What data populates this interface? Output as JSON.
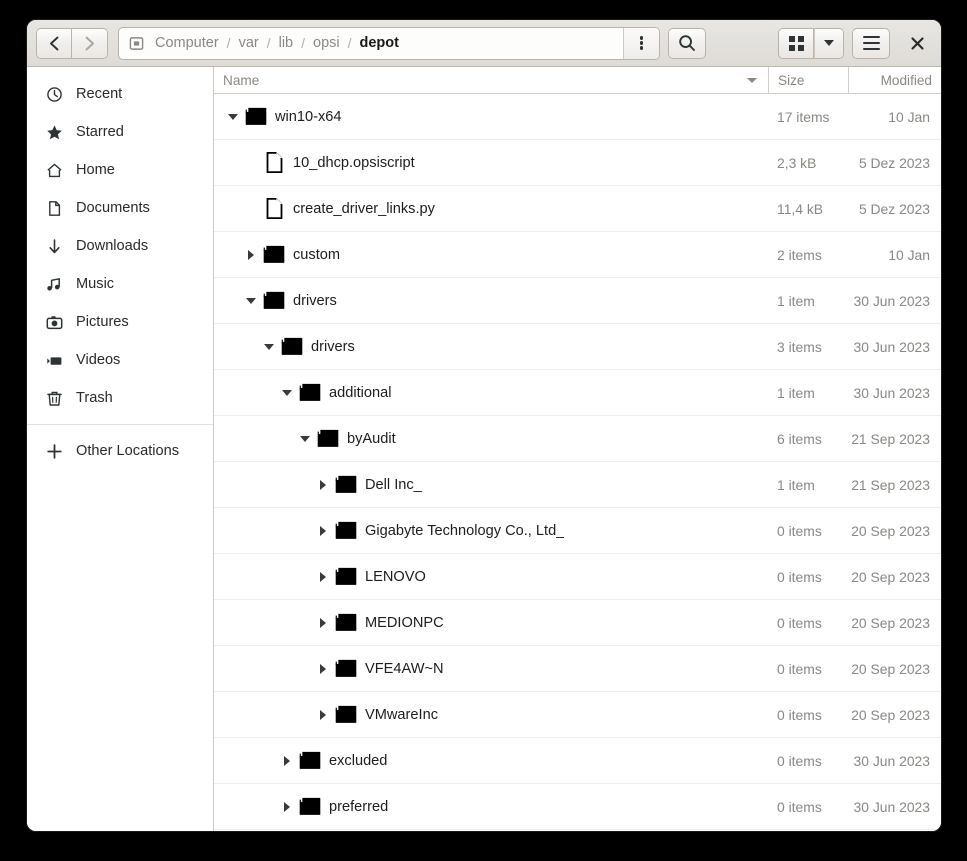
{
  "window": {
    "title": "depot",
    "close_label": "×"
  },
  "toolbar": {
    "back_label": "‹",
    "forward_label": "›",
    "path_root_icon": "computer-icon",
    "crumbs": [
      {
        "label": "Computer",
        "active": false
      },
      {
        "label": "var",
        "active": false
      },
      {
        "label": "lib",
        "active": false
      },
      {
        "label": "opsi",
        "active": false
      },
      {
        "label": "depot",
        "active": true
      }
    ],
    "separator": "/",
    "kebab_name": "path-options-button",
    "search_name": "search-button",
    "view_grid_name": "grid-view-button",
    "view_dropdown_name": "view-options-dropdown",
    "menu_name": "main-menu-button"
  },
  "sidebar": {
    "items": [
      {
        "label": "Recent",
        "icon": "clock-icon"
      },
      {
        "label": "Starred",
        "icon": "star-icon"
      },
      {
        "label": "Home",
        "icon": "home-icon"
      },
      {
        "label": "Documents",
        "icon": "document-icon"
      },
      {
        "label": "Downloads",
        "icon": "download-arrow-icon"
      },
      {
        "label": "Music",
        "icon": "music-note-icon"
      },
      {
        "label": "Pictures",
        "icon": "camera-icon"
      },
      {
        "label": "Videos",
        "icon": "video-icon"
      },
      {
        "label": "Trash",
        "icon": "trash-icon"
      }
    ],
    "other_locations": {
      "label": "Other Locations",
      "icon": "plus-icon"
    }
  },
  "columns": {
    "name": "Name",
    "size": "Size",
    "modified": "Modified",
    "sort_on": "name",
    "sort_direction": "descending"
  },
  "rows": [
    {
      "name": "win10-x64",
      "type": "folder",
      "depth": 0,
      "expander": "down",
      "size": "17 items",
      "modified": "10 Jan"
    },
    {
      "name": "10_dhcp.opsiscript",
      "type": "file",
      "depth": 1,
      "expander": "none",
      "size": "2,3 kB",
      "modified": "5 Dez 2023"
    },
    {
      "name": "create_driver_links.py",
      "type": "file",
      "depth": 1,
      "expander": "none",
      "size": "11,4 kB",
      "modified": "5 Dez 2023"
    },
    {
      "name": "custom",
      "type": "folder",
      "depth": 1,
      "expander": "right",
      "size": "2 items",
      "modified": "10 Jan"
    },
    {
      "name": "drivers",
      "type": "folder",
      "depth": 1,
      "expander": "down",
      "size": "1 item",
      "modified": "30 Jun 2023"
    },
    {
      "name": "drivers",
      "type": "folder",
      "depth": 2,
      "expander": "down",
      "size": "3 items",
      "modified": "30 Jun 2023"
    },
    {
      "name": "additional",
      "type": "folder",
      "depth": 3,
      "expander": "down",
      "size": "1 item",
      "modified": "30 Jun 2023"
    },
    {
      "name": "byAudit",
      "type": "folder",
      "depth": 4,
      "expander": "down",
      "size": "6 items",
      "modified": "21 Sep 2023"
    },
    {
      "name": "Dell Inc_",
      "type": "folder",
      "depth": 5,
      "expander": "right",
      "size": "1 item",
      "modified": "21 Sep 2023"
    },
    {
      "name": "Gigabyte Technology Co., Ltd_",
      "type": "folder",
      "depth": 5,
      "expander": "right",
      "size": "0 items",
      "modified": "20 Sep 2023"
    },
    {
      "name": "LENOVO",
      "type": "folder",
      "depth": 5,
      "expander": "right",
      "size": "0 items",
      "modified": "20 Sep 2023"
    },
    {
      "name": "MEDIONPC",
      "type": "folder",
      "depth": 5,
      "expander": "right",
      "size": "0 items",
      "modified": "20 Sep 2023"
    },
    {
      "name": "VFE4AW~N",
      "type": "folder",
      "depth": 5,
      "expander": "right",
      "size": "0 items",
      "modified": "20 Sep 2023"
    },
    {
      "name": "VMwareInc",
      "type": "folder",
      "depth": 5,
      "expander": "right",
      "size": "0 items",
      "modified": "20 Sep 2023"
    },
    {
      "name": "excluded",
      "type": "folder",
      "depth": 3,
      "expander": "right",
      "size": "0 items",
      "modified": "30 Jun 2023"
    },
    {
      "name": "preferred",
      "type": "folder",
      "depth": 3,
      "expander": "right",
      "size": "0 items",
      "modified": "30 Jun 2023"
    }
  ],
  "colors": {
    "folder": "#000000",
    "chrome": "#e4e1dd",
    "text": "#1d1d1d",
    "muted": "#8b8783"
  }
}
